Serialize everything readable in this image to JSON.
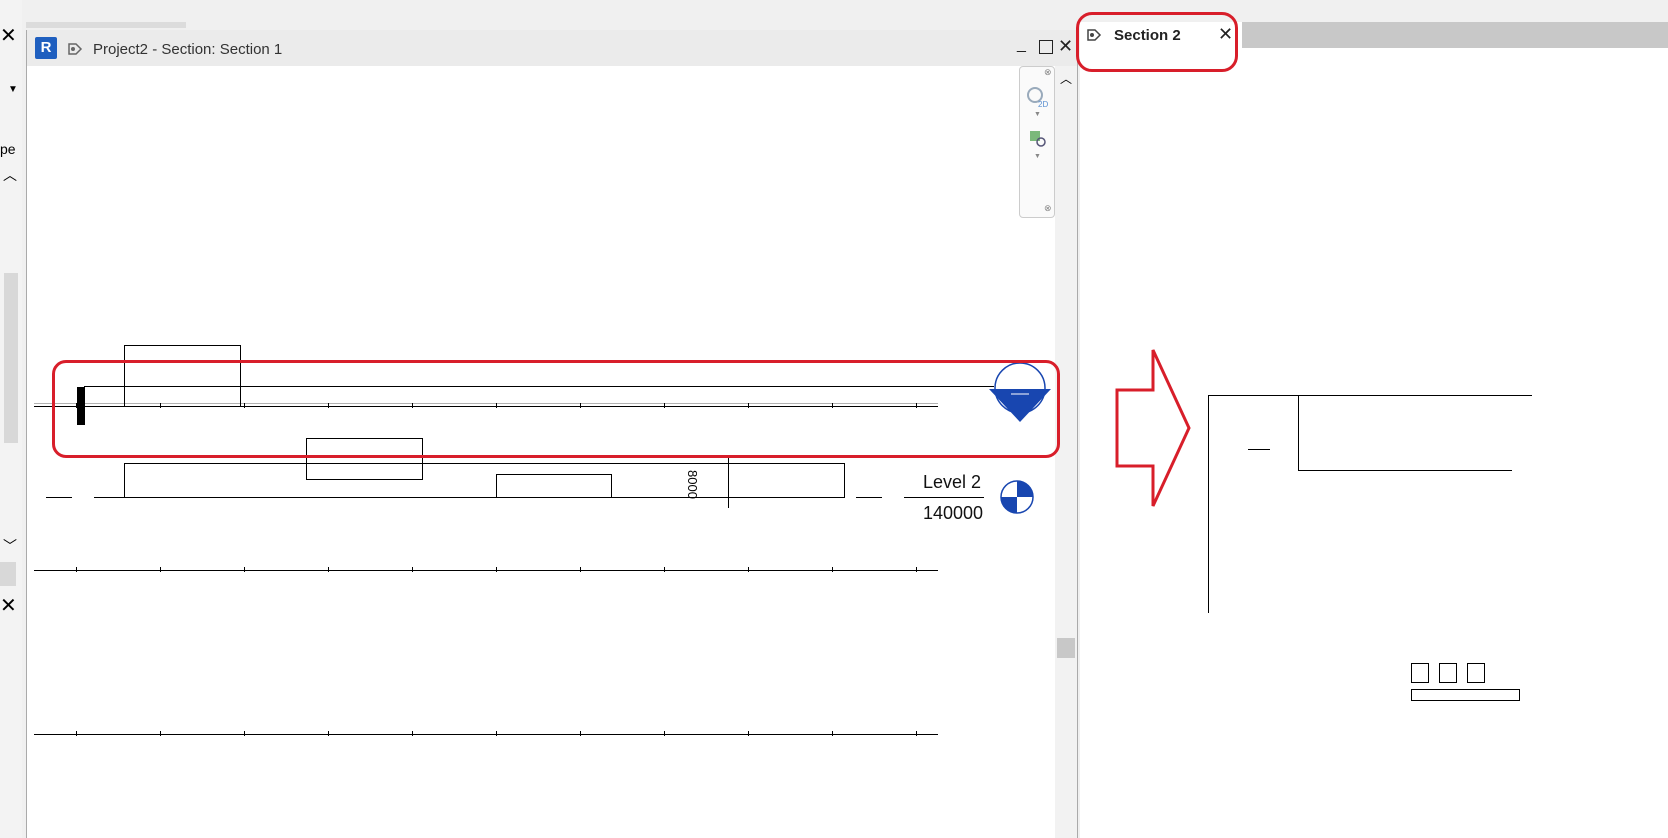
{
  "colors": {
    "accent_red": "#d81e2a",
    "revit_blue": "#1f5fbf",
    "level_blue": "#1846b0"
  },
  "main_view": {
    "app_icon_letter": "R",
    "title": "Project2 - Section: Section 1",
    "level_name": "Level 2",
    "level_elevation": "140000",
    "dimension_value": "8000"
  },
  "side_panel": {
    "partial_text": "pe"
  },
  "section2_view": {
    "tab_label": "Section 2"
  },
  "icons": [
    "close-icon",
    "minimize-icon",
    "maximize-icon",
    "section-view-icon",
    "chevron-up-icon",
    "chevron-down-icon",
    "dropdown-arrow-icon",
    "zoom-2d-icon",
    "zoom-region-icon"
  ]
}
